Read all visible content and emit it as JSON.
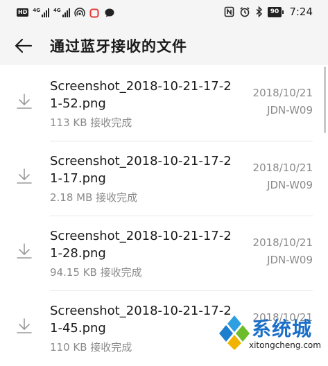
{
  "status_bar": {
    "hd_badge": "HD",
    "network_1": "4G",
    "network_2": "4G",
    "battery": "90",
    "time": "7:24",
    "icons": [
      "hotspot-icon",
      "notification-icon",
      "message-icon",
      "nfc-icon",
      "alarm-icon",
      "bluetooth-icon"
    ]
  },
  "header": {
    "title": "通过蓝牙接收的文件",
    "back_icon": "arrow-left-icon"
  },
  "files": [
    {
      "name": "Screenshot_2018-10-21-17-21-52.png",
      "status": "113 KB 接收完成",
      "date": "2018/10/21",
      "device": "JDN-W09"
    },
    {
      "name": "Screenshot_2018-10-21-17-21-17.png",
      "status": "2.18 MB 接收完成",
      "date": "2018/10/21",
      "device": "JDN-W09"
    },
    {
      "name": "Screenshot_2018-10-21-17-21-28.png",
      "status": "94.15 KB 接收完成",
      "date": "2018/10/21",
      "device": "JDN-W09"
    },
    {
      "name": "Screenshot_2018-10-21-17-21-45.png",
      "status": "110 KB 接收完成",
      "date": "2018/10/21",
      "device": ""
    }
  ],
  "watermark": {
    "text": "系统城",
    "url": "xitongcheng.com"
  },
  "colors": {
    "header_bg": "#f5f5f5",
    "secondary_text": "#8a8a8a",
    "watermark_blue": "#1a6fc8"
  }
}
